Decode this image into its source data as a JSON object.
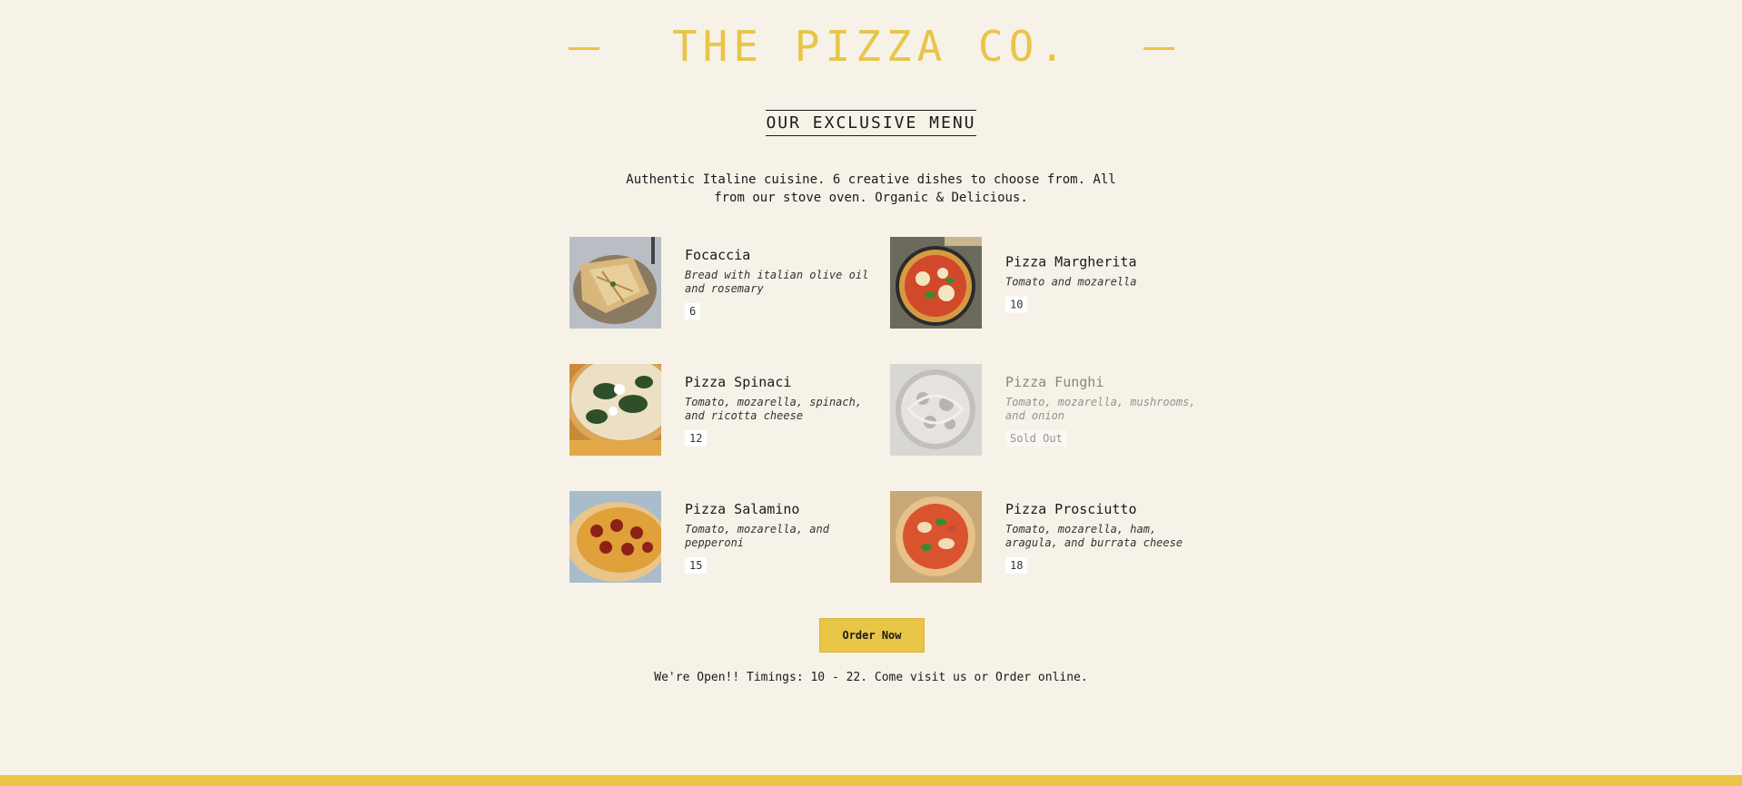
{
  "header": {
    "title": "THE PIZZA CO."
  },
  "menu": {
    "heading": "OUR EXCLUSIVE MENU",
    "intro": "Authentic Italine cuisine. 6 creative dishes to choose from. All from our stove oven. Organic & Delicious.",
    "items": [
      {
        "name": "Focaccia",
        "description": "Bread with italian olive oil and rosemary",
        "price": "6",
        "sold_out": false
      },
      {
        "name": "Pizza Margherita",
        "description": "Tomato and mozarella",
        "price": "10",
        "sold_out": false
      },
      {
        "name": "Pizza Spinaci",
        "description": "Tomato, mozarella, spinach, and ricotta cheese",
        "price": "12",
        "sold_out": false
      },
      {
        "name": "Pizza Funghi",
        "description": "Tomato, mozarella, mushrooms, and onion",
        "price": "Sold Out",
        "sold_out": true
      },
      {
        "name": "Pizza Salamino",
        "description": "Tomato, mozarella, and pepperoni",
        "price": "15",
        "sold_out": false
      },
      {
        "name": "Pizza Prosciutto",
        "description": "Tomato, mozarella, ham, aragula, and burrata cheese",
        "price": "18",
        "sold_out": false
      }
    ]
  },
  "order_button": "Order Now",
  "footer": {
    "note": "We're Open!! Timings: 10 - 22. Come visit us or Order online."
  },
  "colors": {
    "accent": "#e8c547",
    "background": "#f7f2e8",
    "text": "#1a1a1a"
  }
}
